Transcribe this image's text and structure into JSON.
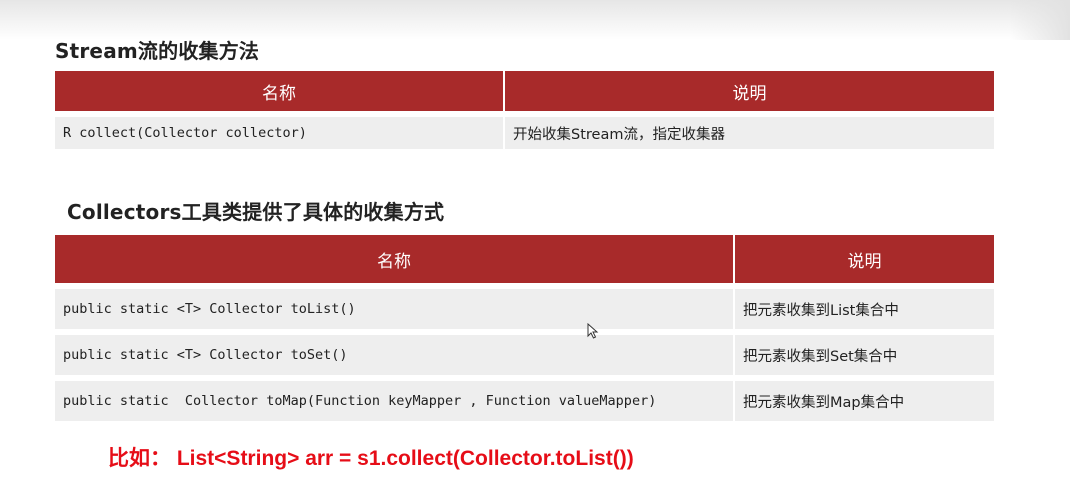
{
  "section1": {
    "title": "Stream流的收集方法",
    "headers": [
      "名称",
      "说明"
    ],
    "rows": [
      {
        "name": "R collect(Collector collector)",
        "desc": "开始收集Stream流，指定收集器"
      }
    ]
  },
  "section2": {
    "title": "Collectors工具类提供了具体的收集方式",
    "headers": [
      "名称",
      "说明"
    ],
    "rows": [
      {
        "name": "public static <T> Collector toList()",
        "desc": "把元素收集到List集合中"
      },
      {
        "name": "public static <T> Collector toSet()",
        "desc": "把元素收集到Set集合中"
      },
      {
        "name": "public static  Collector toMap(Function keyMapper , Function valueMapper)",
        "desc": "把元素收集到Map集合中"
      }
    ]
  },
  "example": "比如： List<String> arr = s1.collect(Collector.toList())",
  "colors": {
    "header_bg": "#a82a2a",
    "row_bg": "#eeeeee",
    "example_text": "#e60d17"
  },
  "icons": [
    "mouse-cursor-icon"
  ]
}
